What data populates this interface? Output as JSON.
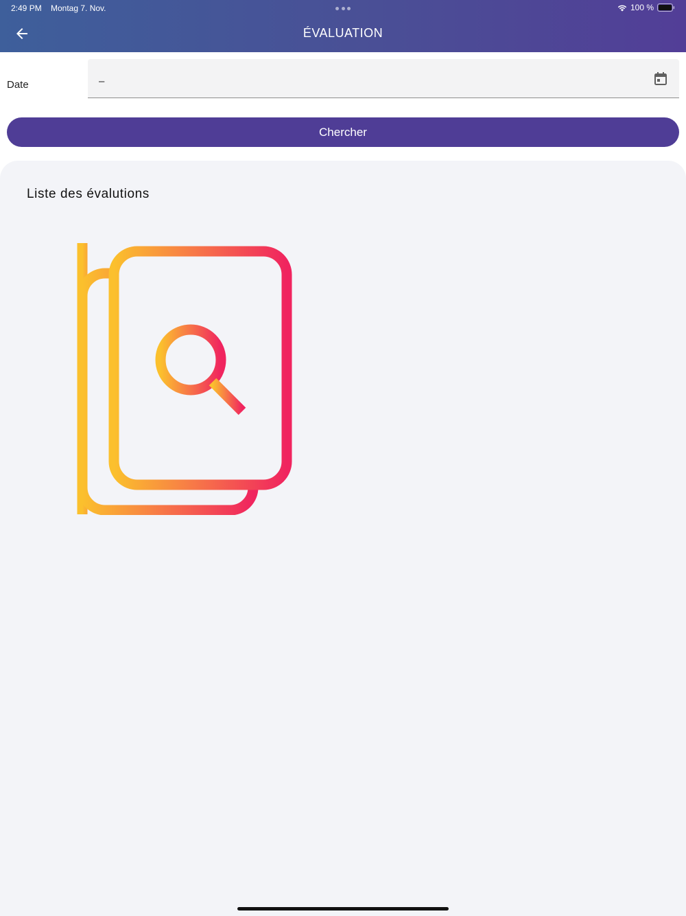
{
  "status_bar": {
    "time": "2:49 PM",
    "date": "Montag 7. Nov.",
    "battery": "100 %"
  },
  "header": {
    "title": "ÉVALUATION",
    "back_icon": "arrow-left-icon"
  },
  "filter": {
    "date_label": "Date",
    "date_value": "–",
    "calendar_icon": "calendar-icon",
    "search_label": "Chercher"
  },
  "list": {
    "title": "Liste des évalutions",
    "empty_icon": "document-search-icon"
  },
  "colors": {
    "header_gradient_start": "#3e5f9b",
    "header_gradient_end": "#523e97",
    "button": "#4f3d96",
    "panel_background": "#f3f4f8",
    "illustration_gradient_start": "#fbc02d",
    "illustration_gradient_end": "#f0245f"
  }
}
